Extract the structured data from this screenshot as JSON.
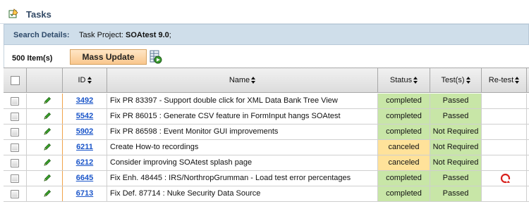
{
  "page": {
    "title": "Tasks",
    "title_icon": "checklist-pencil-icon"
  },
  "search": {
    "label": "Search Details:",
    "prefix": "Task Project: ",
    "project": "SOAtest 9.0",
    "suffix": ";"
  },
  "toolbar": {
    "item_count": "500 Item(s)",
    "mass_update_label": "Mass Update",
    "export_icon": "grid-export-icon"
  },
  "columns": {
    "id": "ID",
    "name": "Name",
    "status": "Status",
    "tests": "Test(s)",
    "retest": "Re-test"
  },
  "colors": {
    "completed": "#c8e6a7",
    "canceled": "#ffe29a",
    "link": "#1a55c9",
    "retest_icon": "#d8201c"
  },
  "rows": [
    {
      "id": "3492",
      "name": "Fix PR 83397 - Support double click for XML Data Bank Tree View",
      "status": "completed",
      "tests": "Passed",
      "retest": false
    },
    {
      "id": "5542",
      "name": "Fix PR 86015 : Generate CSV feature in FormInput hangs SOAtest",
      "status": "completed",
      "tests": "Passed",
      "retest": false
    },
    {
      "id": "5902",
      "name": "Fix PR 86598 : Event Monitor GUI improvements",
      "status": "completed",
      "tests": "Not Required",
      "retest": false
    },
    {
      "id": "6211",
      "name": "Create How-to recordings",
      "status": "canceled",
      "tests": "Not Required",
      "retest": false
    },
    {
      "id": "6212",
      "name": "Consider improving SOAtest splash page",
      "status": "canceled",
      "tests": "Not Required",
      "retest": false
    },
    {
      "id": "6645",
      "name": "Fix Enh. 48445 : IRS/NorthropGrumman - Load test error percentages",
      "status": "completed",
      "tests": "Passed",
      "retest": true
    },
    {
      "id": "6713",
      "name": "Fix Def. 87714 : Nuke Security Data Source",
      "status": "completed",
      "tests": "Passed",
      "retest": false
    }
  ]
}
